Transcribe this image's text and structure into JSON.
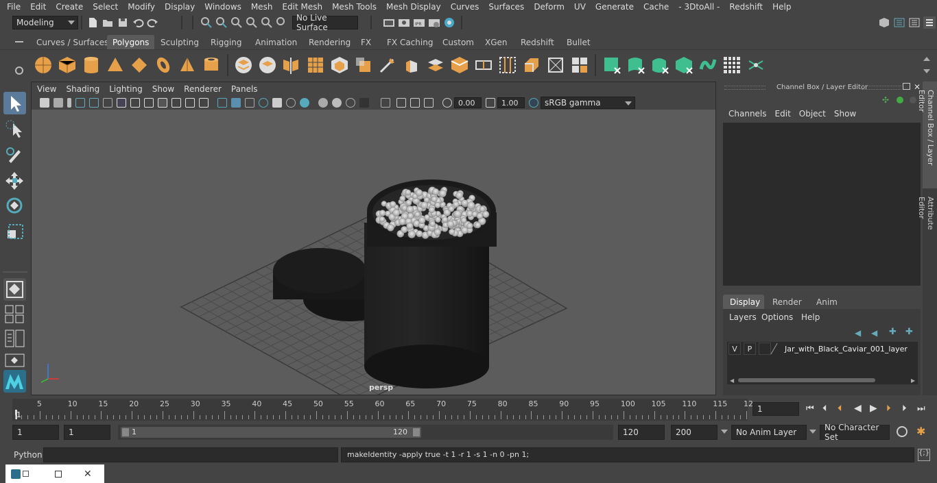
{
  "menubar": [
    "File",
    "Edit",
    "Create",
    "Select",
    "Modify",
    "Display",
    "Windows",
    "Mesh",
    "Edit Mesh",
    "Mesh Tools",
    "Mesh Display",
    "Curves",
    "Surfaces",
    "Deform",
    "UV",
    "Generate",
    "Cache",
    "- 3DtoAll -",
    "Redshift",
    "Help"
  ],
  "status": {
    "mode": "Modeling",
    "live_surface": "No Live Surface"
  },
  "shelf_tabs": [
    "Curves / Surfaces",
    "Polygons",
    "Sculpting",
    "Rigging",
    "Animation",
    "Rendering",
    "FX",
    "FX Caching",
    "Custom",
    "XGen",
    "Redshift",
    "Bullet"
  ],
  "shelf_active": "Polygons",
  "viewport": {
    "menu": [
      "View",
      "Shading",
      "Lighting",
      "Show",
      "Renderer",
      "Panels"
    ],
    "exposure": "0.00",
    "gamma": "1.00",
    "colorspace": "sRGB gamma",
    "camera": "persp"
  },
  "channel_box": {
    "title": "Channel Box / Layer Editor",
    "menu": [
      "Channels",
      "Edit",
      "Object",
      "Show"
    ]
  },
  "layer_editor": {
    "tabs": [
      "Display",
      "Render",
      "Anim"
    ],
    "active_tab": "Display",
    "menu": [
      "Layers",
      "Options",
      "Help"
    ],
    "layer": {
      "v": "V",
      "p": "P",
      "name": "Jar_with_Black_Caviar_001_layer"
    }
  },
  "side_tabs": [
    "Channel Box / Layer Editor",
    "Attribute Editor"
  ],
  "timeline": {
    "ticks": [
      "5",
      "10",
      "15",
      "20",
      "25",
      "30",
      "35",
      "40",
      "45",
      "50",
      "55",
      "60",
      "65",
      "70",
      "75",
      "80",
      "85",
      "90",
      "95",
      "100",
      "105",
      "110",
      "115",
      "12"
    ],
    "start_label": "1",
    "current_frame": "1"
  },
  "range": {
    "start": "1",
    "current": "1",
    "slider_start": "1",
    "slider_end": "120",
    "end": "120",
    "max": "200",
    "anim_layer": "No Anim Layer",
    "char_set": "No Character Set"
  },
  "cmd": {
    "lang": "Python",
    "output": "makeIdentity -apply true -t 1 -r 1 -s 1 -n 0 -pn 1;"
  },
  "colors": {
    "accent": "#5a8fb0",
    "shelf_orange": "#e6a04a",
    "shelf_green": "#3fbf8f",
    "active_tool": "#5c7a99"
  }
}
